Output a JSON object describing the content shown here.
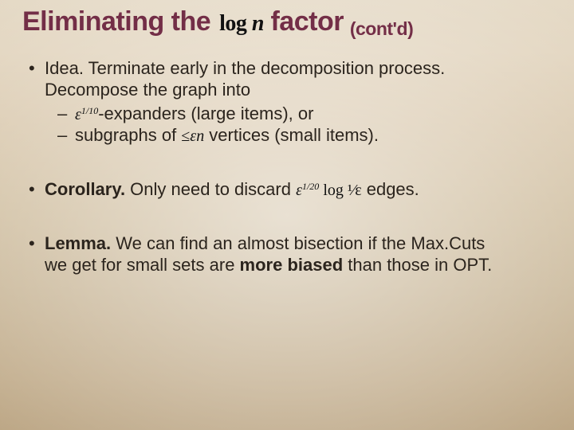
{
  "title": {
    "pre": "Eliminating the ",
    "math_fn": "log",
    "math_var": "n",
    "post": " factor",
    "sub": " (cont'd)"
  },
  "bullets": {
    "b1": {
      "line1": "Idea. Terminate early in the decomposition process.",
      "line2": "Decompose the graph into",
      "sub1_math": "ε",
      "sub1_exp": "1/10",
      "sub1_rest": "-expanders (large items), or",
      "sub2_pre": "subgraphs of ",
      "sub2_math_le": "≤",
      "sub2_math_e": "ε",
      "sub2_math_n": "n",
      "sub2_rest": " vertices (small items)."
    },
    "b2": {
      "pre": "Corollary.",
      "mid": " Only need to discard ",
      "m_e": "ε",
      "m_exp": "1/20",
      "m_log": " log",
      "m_frac": " ¹⁄ε",
      "rest": "  edges."
    },
    "b3": {
      "pre": "Lemma.",
      "line1": " We can find an almost bisection if the Max.Cuts",
      "line2a": "we get for small sets are ",
      "bold": "more biased",
      "line2b": " than those in OPT."
    }
  }
}
